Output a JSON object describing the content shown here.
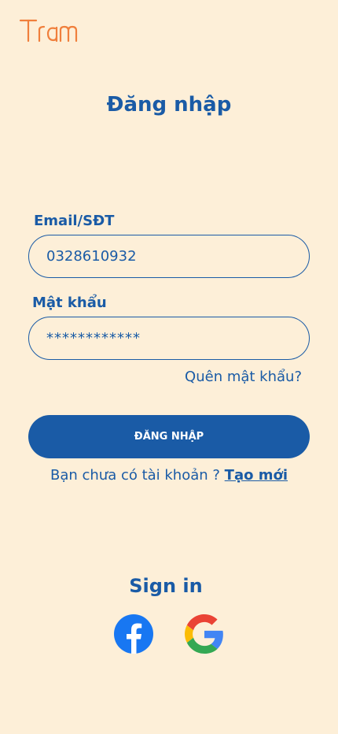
{
  "brand": {
    "logo_text": "Tram",
    "logo_color": "#F07F3C"
  },
  "page": {
    "title": "Đăng nhập",
    "background": "#FDEFD8",
    "accent": "#1A5BA6"
  },
  "form": {
    "email_label": "Email/SĐT",
    "email_value": "0328610932",
    "password_label": "Mật khẩu",
    "password_value": "************",
    "forgot_label": "Quên mật khẩu?",
    "submit_label": "ĐĂNG NHẬP"
  },
  "signup": {
    "prompt": "Bạn chưa có tài khoản ? ",
    "link_label": "Tạo mới"
  },
  "social": {
    "title": "Sign in",
    "providers": [
      {
        "name": "facebook",
        "icon": "facebook-icon",
        "color": "#1877F2"
      },
      {
        "name": "google",
        "icon": "google-icon"
      }
    ]
  }
}
